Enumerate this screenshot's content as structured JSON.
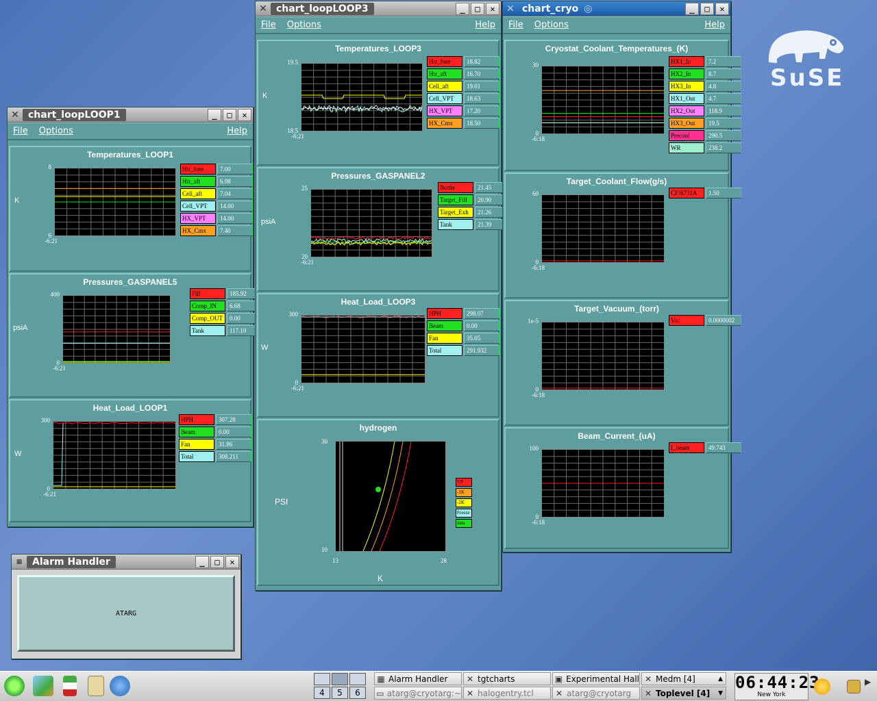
{
  "desktop": {
    "logo_text": "SuSE"
  },
  "win_loop1": {
    "title": "chart_loopLOOP1",
    "menu": {
      "file": "File",
      "options": "Options",
      "help": "Help"
    },
    "panels": [
      {
        "title": "Temperatures_LOOP1",
        "ylabel": "K",
        "ymax": "8",
        "ymin": "6",
        "xtick": "-6:21",
        "legend": [
          {
            "name": "Htr_fore",
            "value": "7.00",
            "color": "#ff2020"
          },
          {
            "name": "Htr_aft",
            "value": "6.98",
            "color": "#20e020"
          },
          {
            "name": "Cell_aft",
            "value": "7.04",
            "color": "#ffff00"
          },
          {
            "name": "Cell_VPT",
            "value": "14.00",
            "color": "#a0f0f0"
          },
          {
            "name": "HX_VPT",
            "value": "14.00",
            "color": "#ff80ff"
          },
          {
            "name": "HX_Cmx",
            "value": "7.40",
            "color": "#ffa020"
          }
        ]
      },
      {
        "title": "Pressures_GASPANEL5",
        "ylabel": "psiA",
        "ymax": "400",
        "ymin": "0",
        "xtick": "-6:21",
        "legend": [
          {
            "name": "Fill",
            "value": "185.92",
            "color": "#ff2020"
          },
          {
            "name": "Comp_IN",
            "value": "6.68",
            "color": "#20e020"
          },
          {
            "name": "Comp_OUT",
            "value": "0.00",
            "color": "#ffff00"
          },
          {
            "name": "Tank",
            "value": "117.10",
            "color": "#a0f0f0"
          }
        ]
      },
      {
        "title": "Heat_Load_LOOP1",
        "ylabel": "W",
        "ymax": "300",
        "ymin": "0",
        "xtick": "-6:21",
        "legend": [
          {
            "name": "HPH",
            "value": "307.28",
            "color": "#ff2020"
          },
          {
            "name": "Beam",
            "value": "0.00",
            "color": "#20e020"
          },
          {
            "name": "Fan",
            "value": "31.86",
            "color": "#ffff00"
          },
          {
            "name": "Total",
            "value": "308.211",
            "color": "#a0f0f0"
          }
        ]
      }
    ]
  },
  "win_loop3": {
    "title": "chart_loopLOOP3",
    "menu": {
      "file": "File",
      "options": "Options",
      "help": "Help"
    },
    "panels": [
      {
        "title": "Temperatures_LOOP3",
        "ylabel": "K",
        "ymax": "19.5",
        "ymin": "18.5",
        "xtick": "-6:21",
        "legend": [
          {
            "name": "Htr_fore",
            "value": "18.82",
            "color": "#ff2020"
          },
          {
            "name": "Htr_aft",
            "value": "16.70",
            "color": "#20e020"
          },
          {
            "name": "Cell_aft",
            "value": "19.01",
            "color": "#ffff00"
          },
          {
            "name": "Cell_VPT",
            "value": "18.63",
            "color": "#a0f0f0"
          },
          {
            "name": "HX_VPT",
            "value": "17.20",
            "color": "#ff80ff"
          },
          {
            "name": "HX_Cmx",
            "value": "18.50",
            "color": "#ffa020"
          }
        ]
      },
      {
        "title": "Pressures_GASPANEL2",
        "ylabel": "psiA",
        "ymax": "25",
        "ymin": "20",
        "xtick": "-6:21",
        "legend": [
          {
            "name": "Bottle",
            "value": "21.45",
            "color": "#ff2020"
          },
          {
            "name": "Target_Fill",
            "value": "20.90",
            "color": "#20e020"
          },
          {
            "name": "Target_Exh",
            "value": "21.26",
            "color": "#ffff00"
          },
          {
            "name": "Tank",
            "value": "21.39",
            "color": "#a0f0f0"
          }
        ]
      },
      {
        "title": "Heat_Load_LOOP3",
        "ylabel": "W",
        "ymax": "300",
        "ymin": "0",
        "xtick": "-6:21",
        "legend": [
          {
            "name": "HPH",
            "value": "298.07",
            "color": "#ff2020"
          },
          {
            "name": "Beam",
            "value": "0.00",
            "color": "#20e020"
          },
          {
            "name": "Fan",
            "value": "35.05",
            "color": "#ffff00"
          },
          {
            "name": "Total",
            "value": "291.932",
            "color": "#a0f0f0"
          }
        ]
      }
    ],
    "hydrogen": {
      "title": "hydrogen",
      "ylabel": "PSI",
      "xlabel": "K",
      "ymax": "30",
      "ymin": "10",
      "xmin": "13",
      "xmax": "28",
      "legend": [
        {
          "name": "VP",
          "color": "#ff2020"
        },
        {
          "name": "-1K",
          "color": "#ffa020"
        },
        {
          "name": "-2K",
          "color": "#ffff00"
        },
        {
          "name": "Freeze",
          "color": "#a0f0f0"
        },
        {
          "name": "data",
          "color": "#20e020"
        }
      ]
    }
  },
  "win_cryo": {
    "title": "chart_cryo",
    "menu": {
      "file": "File",
      "options": "Options",
      "help": "Help"
    },
    "panels": [
      {
        "title": "Cryostat_Coolant_Temperatures_(K)",
        "ymax": "30",
        "ymin": "0",
        "xtick": "-6:18",
        "legend": [
          {
            "name": "HX1_In",
            "value": "7.2",
            "color": "#ff2020"
          },
          {
            "name": "HX2_In",
            "value": "8.7",
            "color": "#20e020"
          },
          {
            "name": "HX3_In",
            "value": "4.8",
            "color": "#ffff00"
          },
          {
            "name": "HX1_Out",
            "value": "4.7",
            "color": "#a0f0f0"
          },
          {
            "name": "HX2_Out",
            "value": "118.9",
            "color": "#ff80ff"
          },
          {
            "name": "HX3_Out",
            "value": "19.5",
            "color": "#ffa020"
          },
          {
            "name": "Precool",
            "value": "290.5",
            "color": "#ff3090"
          },
          {
            "name": "WR",
            "value": "238.2",
            "color": "#a0f0d0"
          }
        ]
      },
      {
        "title": "Target_Coolant_Flow(g/s)",
        "ymax": "60",
        "ymin": "0",
        "xtick": "-6:18",
        "legend": [
          {
            "name": "CFI6731A",
            "value": "1.50",
            "color": "#ff2020"
          }
        ]
      },
      {
        "title": "Target_Vacuum_(torr)",
        "ymax": "1e-5",
        "ymin": "0",
        "xtick": "-6:18",
        "legend": [
          {
            "name": "Vac",
            "value": "0.0000002",
            "color": "#ff2020"
          }
        ]
      },
      {
        "title": "Beam_Current_(uA)",
        "ymax": "100",
        "ymin": "0",
        "xtick": "-6:18",
        "legend": [
          {
            "name": "I_beam",
            "value": "49.743",
            "color": "#ff2020"
          }
        ]
      }
    ]
  },
  "alarm": {
    "title": "Alarm Handler",
    "label": "ATARG"
  },
  "taskbar": {
    "pager": [
      "4",
      "5",
      "6"
    ],
    "tasks": [
      {
        "label": "Alarm Handler"
      },
      {
        "label": "tgtcharts"
      },
      {
        "label": "Experimental Hall"
      },
      {
        "label": "Medm [4]"
      },
      {
        "label": "atarg@cryotarg:~"
      },
      {
        "label": "halogentry.tcl"
      },
      {
        "label": "atarg@cryotarg"
      },
      {
        "label": "Toplevel [4]"
      }
    ],
    "clock": {
      "time": "06:44:23",
      "city": "New York"
    }
  }
}
